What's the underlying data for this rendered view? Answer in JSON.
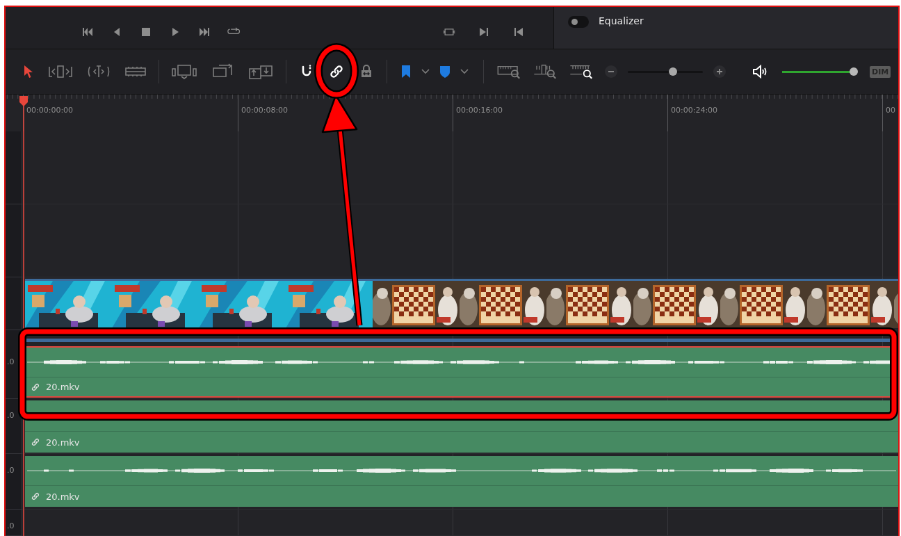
{
  "equalizer": {
    "label": "Equalizer",
    "on": false
  },
  "edit_tools": [
    {
      "kind": "select",
      "selected": true
    },
    {
      "kind": "trim",
      "selected": false
    },
    {
      "kind": "dynamic_trim",
      "selected": false
    },
    {
      "kind": "blade",
      "selected": false
    }
  ],
  "toggles": [
    {
      "kind": "snapping",
      "on": true
    },
    {
      "kind": "linked_selection",
      "on": true
    },
    {
      "kind": "position_lock",
      "on": false
    }
  ],
  "zoom_slider": {
    "level": 0.6
  },
  "volume_slider": {
    "level": 0.95
  },
  "dim_button": {
    "label": "DIM"
  },
  "ruler": {
    "timecodes": [
      "00:00:00:00",
      "00:00:08:00",
      "00:00:16:00",
      "00:00:24:00",
      "00"
    ]
  },
  "tracks": [
    {
      "kind": "empty"
    },
    {
      "kind": "empty"
    },
    {
      "kind": "video"
    },
    {
      "kind": "audio",
      "header": ".0",
      "clip": {
        "name": "20.mkv",
        "linked": true,
        "selected": true,
        "waveform": true
      }
    },
    {
      "kind": "audio",
      "header": ".0",
      "clip": {
        "name": "20.mkv",
        "linked": true,
        "selected": false,
        "waveform": false
      }
    },
    {
      "kind": "audio",
      "header": ".0",
      "clip": {
        "name": "20.mkv",
        "linked": true,
        "selected": false,
        "waveform": true
      }
    },
    {
      "kind": "audio",
      "header": ".0"
    }
  ]
}
